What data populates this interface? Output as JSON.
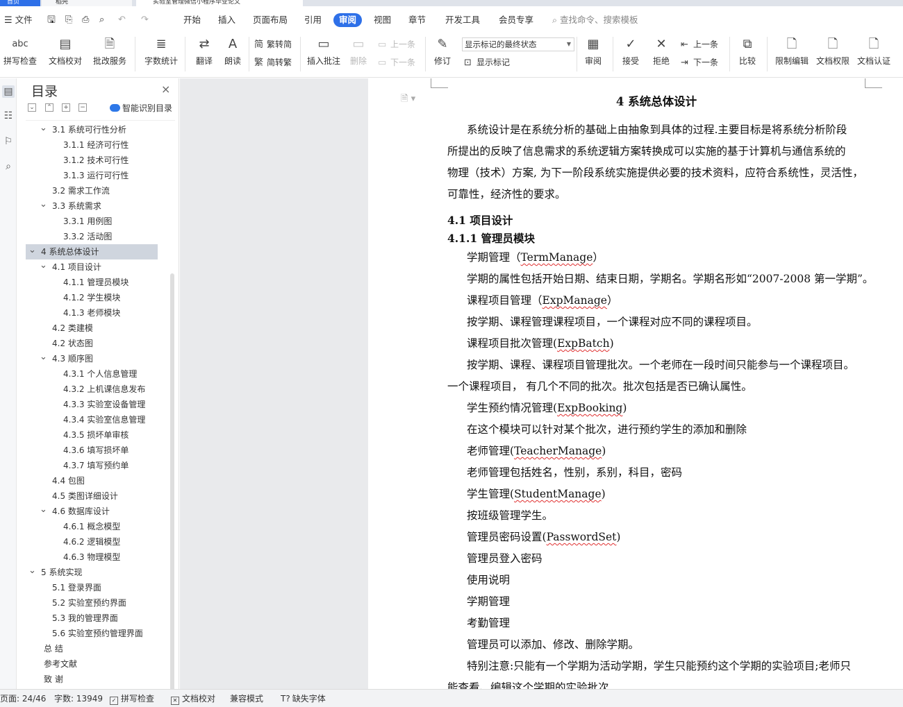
{
  "title_bar": {
    "tabs": [
      {
        "label": "首页",
        "color": "#2e70e8",
        "text": "#fff"
      },
      {
        "label": "稻壳",
        "color": "#f5f6f8",
        "text": "#333"
      },
      {
        "label": "实验室管理微信小程序毕业论文",
        "color": "#fff",
        "text": "#333"
      }
    ]
  },
  "menu": {
    "file_label": "文件",
    "items": [
      "开始",
      "插入",
      "页面布局",
      "引用",
      "审阅",
      "视图",
      "章节",
      "开发工具",
      "会员专享"
    ],
    "active": "审阅",
    "search_placeholder": "查找命令、搜索模板"
  },
  "ribbon": {
    "spell_check": "拼写检查",
    "doc_proof": "文档校对",
    "batch_service": "批改服务",
    "word_count": "字数统计",
    "translate": "翻译",
    "read_aloud": "朗读",
    "trad_to_simp": "繁转简",
    "simp_to_trad": "简转繁",
    "insert_comment": "插入批注",
    "delete": "删除",
    "prev": "上一条",
    "next": "下一条",
    "revision": "修订",
    "markup_select": "显示标记的最终状态",
    "show_markup": "显示标记",
    "review": "审阅",
    "accept": "接受",
    "reject": "拒绝",
    "prev2": "上一条",
    "next2": "下一条",
    "compare": "比较",
    "restrict_edit": "限制编辑",
    "doc_permission": "文档权限",
    "doc_cert": "文档认证"
  },
  "nav": {
    "title": "目录",
    "smart_toc": "智能识别目录",
    "items": [
      {
        "label": "3.1 系统可行性分析",
        "level": 1,
        "expand": true
      },
      {
        "label": "3.1.1 经济可行性",
        "level": 2
      },
      {
        "label": "3.1.2 技术可行性",
        "level": 2
      },
      {
        "label": "3.1.3 运行可行性",
        "level": 2
      },
      {
        "label": "3.2 需求工作流",
        "level": 1
      },
      {
        "label": "3.3 系统需求",
        "level": 1,
        "expand": true
      },
      {
        "label": "3.3.1 用例图",
        "level": 2
      },
      {
        "label": "3.3.2 活动图",
        "level": 2
      },
      {
        "label": "4 系统总体设计",
        "level": 0,
        "expand": true,
        "selected": true
      },
      {
        "label": "4.1 项目设计",
        "level": 1,
        "expand": true
      },
      {
        "label": "4.1.1 管理员模块",
        "level": 2
      },
      {
        "label": "4.1.2 学生模块",
        "level": 2
      },
      {
        "label": "4.1.3 老师模块",
        "level": 2
      },
      {
        "label": "4.2 类建模",
        "level": 1
      },
      {
        "label": "4.2  状态图",
        "level": 1
      },
      {
        "label": "4.3  顺序图",
        "level": 1,
        "expand": true
      },
      {
        "label": "4.3.1 个人信息管理",
        "level": 2
      },
      {
        "label": "4.3.2 上机课信息发布",
        "level": 2
      },
      {
        "label": "4.3.3 实验室设备管理",
        "level": 2
      },
      {
        "label": "4.3.4 实验室信息管理",
        "level": 2
      },
      {
        "label": "4.3.5 损坏单审核",
        "level": 2
      },
      {
        "label": "4.3.6 填写损坏单",
        "level": 2
      },
      {
        "label": "4.3.7 填写预约单",
        "level": 2
      },
      {
        "label": "4.4  包图",
        "level": 1
      },
      {
        "label": "4.5 类图详细设计",
        "level": 1
      },
      {
        "label": "4.6  数据库设计",
        "level": 1,
        "expand": true
      },
      {
        "label": "4.6.1  概念模型",
        "level": 2
      },
      {
        "label": "4.6.2  逻辑模型",
        "level": 2
      },
      {
        "label": "4.6.3  物理模型",
        "level": 2
      },
      {
        "label": "5 系统实现",
        "level": 0,
        "expand": true
      },
      {
        "label": "5.1 登录界面",
        "level": 1
      },
      {
        "label": "5.2  实验室预约界面",
        "level": 1
      },
      {
        "label": "5.3  我的管理界面",
        "level": 1
      },
      {
        "label": "5.6  实验室预约管理界面",
        "level": 1
      },
      {
        "label": "总    结",
        "level": 0,
        "plain": true
      },
      {
        "label": "参考文献",
        "level": 0,
        "plain": true
      },
      {
        "label": "致    谢",
        "level": 0,
        "plain": true
      }
    ]
  },
  "document": {
    "title": "4 系统总体设计",
    "intro": [
      "系统设计是在系统分析的基础上由抽象到具体的过程.主要目标是将系统分析阶段",
      "所提出的反映了信息需求的系统逻辑方案转换成可以实施的基于计算机与通信系统的",
      "物理（技术）方案, 为下一阶段系统实施提供必要的技术资料，应符合系统性，灵活性，",
      "可靠性，经济性的要求。"
    ],
    "h2": "4.1 项目设计",
    "h3": "4.1.1 管理员模块",
    "lines": [
      {
        "pre": "学期管理（",
        "code": "TermManage",
        "post": "）",
        "indent": true
      },
      {
        "pre": "学期的属性包括开始日期、结束日期，学期名。学期名形如“2007-2008 第一学期”。",
        "code": "",
        "post": "",
        "indent": true
      },
      {
        "pre": "课程项目管理（",
        "code": "ExpManage",
        "post": "）",
        "indent": true
      },
      {
        "pre": "按学期、课程管理课程项目，一个课程对应不同的课程项目。",
        "code": "",
        "post": "",
        "indent": true
      },
      {
        "pre": "课程项目批次管理(",
        "code": "ExpBatch",
        "post": ")",
        "indent": true
      },
      {
        "pre": "按学期、课程、课程项目管理批次。一个老师在一段时间只能参与一个课程项目。",
        "code": "",
        "post": "",
        "indent": true
      },
      {
        "pre": "一个课程项目，  有几个不同的批次。批次包括是否已确认属性。",
        "code": "",
        "post": "",
        "indent": false
      },
      {
        "pre": "学生预约情况管理(",
        "code": "ExpBooking",
        "post": ")",
        "indent": true
      },
      {
        "pre": "在这个模块可以针对某个批次，进行预约学生的添加和删除",
        "code": "",
        "post": "",
        "indent": true
      },
      {
        "pre": "老师管理(",
        "code": "TeacherManage",
        "post": ")",
        "indent": true
      },
      {
        "pre": "老师管理包括姓名，性别，系别，科目，密码",
        "code": "",
        "post": "",
        "indent": true
      },
      {
        "pre": "学生管理(",
        "code": "StudentManage",
        "post": ")",
        "indent": true
      },
      {
        "pre": "按班级管理学生。",
        "code": "",
        "post": "",
        "indent": true
      },
      {
        "pre": "管理员密码设置(",
        "code": "PasswordSet",
        "post": ")",
        "indent": true
      },
      {
        "pre": "管理员登入密码",
        "code": "",
        "post": "",
        "indent": true
      },
      {
        "pre": "使用说明",
        "code": "",
        "post": "",
        "indent": true
      },
      {
        "pre": "学期管理",
        "code": "",
        "post": "",
        "indent": true
      },
      {
        "pre": "考勤管理",
        "code": "",
        "post": "",
        "indent": true
      },
      {
        "pre": "管理员可以添加、修改、删除学期。",
        "code": "",
        "post": "",
        "indent": true
      },
      {
        "pre": "特别注意:只能有一个学期为活动学期，学生只能预约这个学期的实验项目;老师只",
        "code": "",
        "post": "",
        "indent": true
      },
      {
        "pre": "能查看、编辑这个学期的实验批次",
        "code": "",
        "post": "",
        "indent": false
      }
    ]
  },
  "status": {
    "page": "页面: 24/46",
    "words": "字数: 13949",
    "spell": "拼写检查",
    "proof": "文档校对",
    "compat": "兼容模式",
    "missing_font": "缺失字体"
  }
}
